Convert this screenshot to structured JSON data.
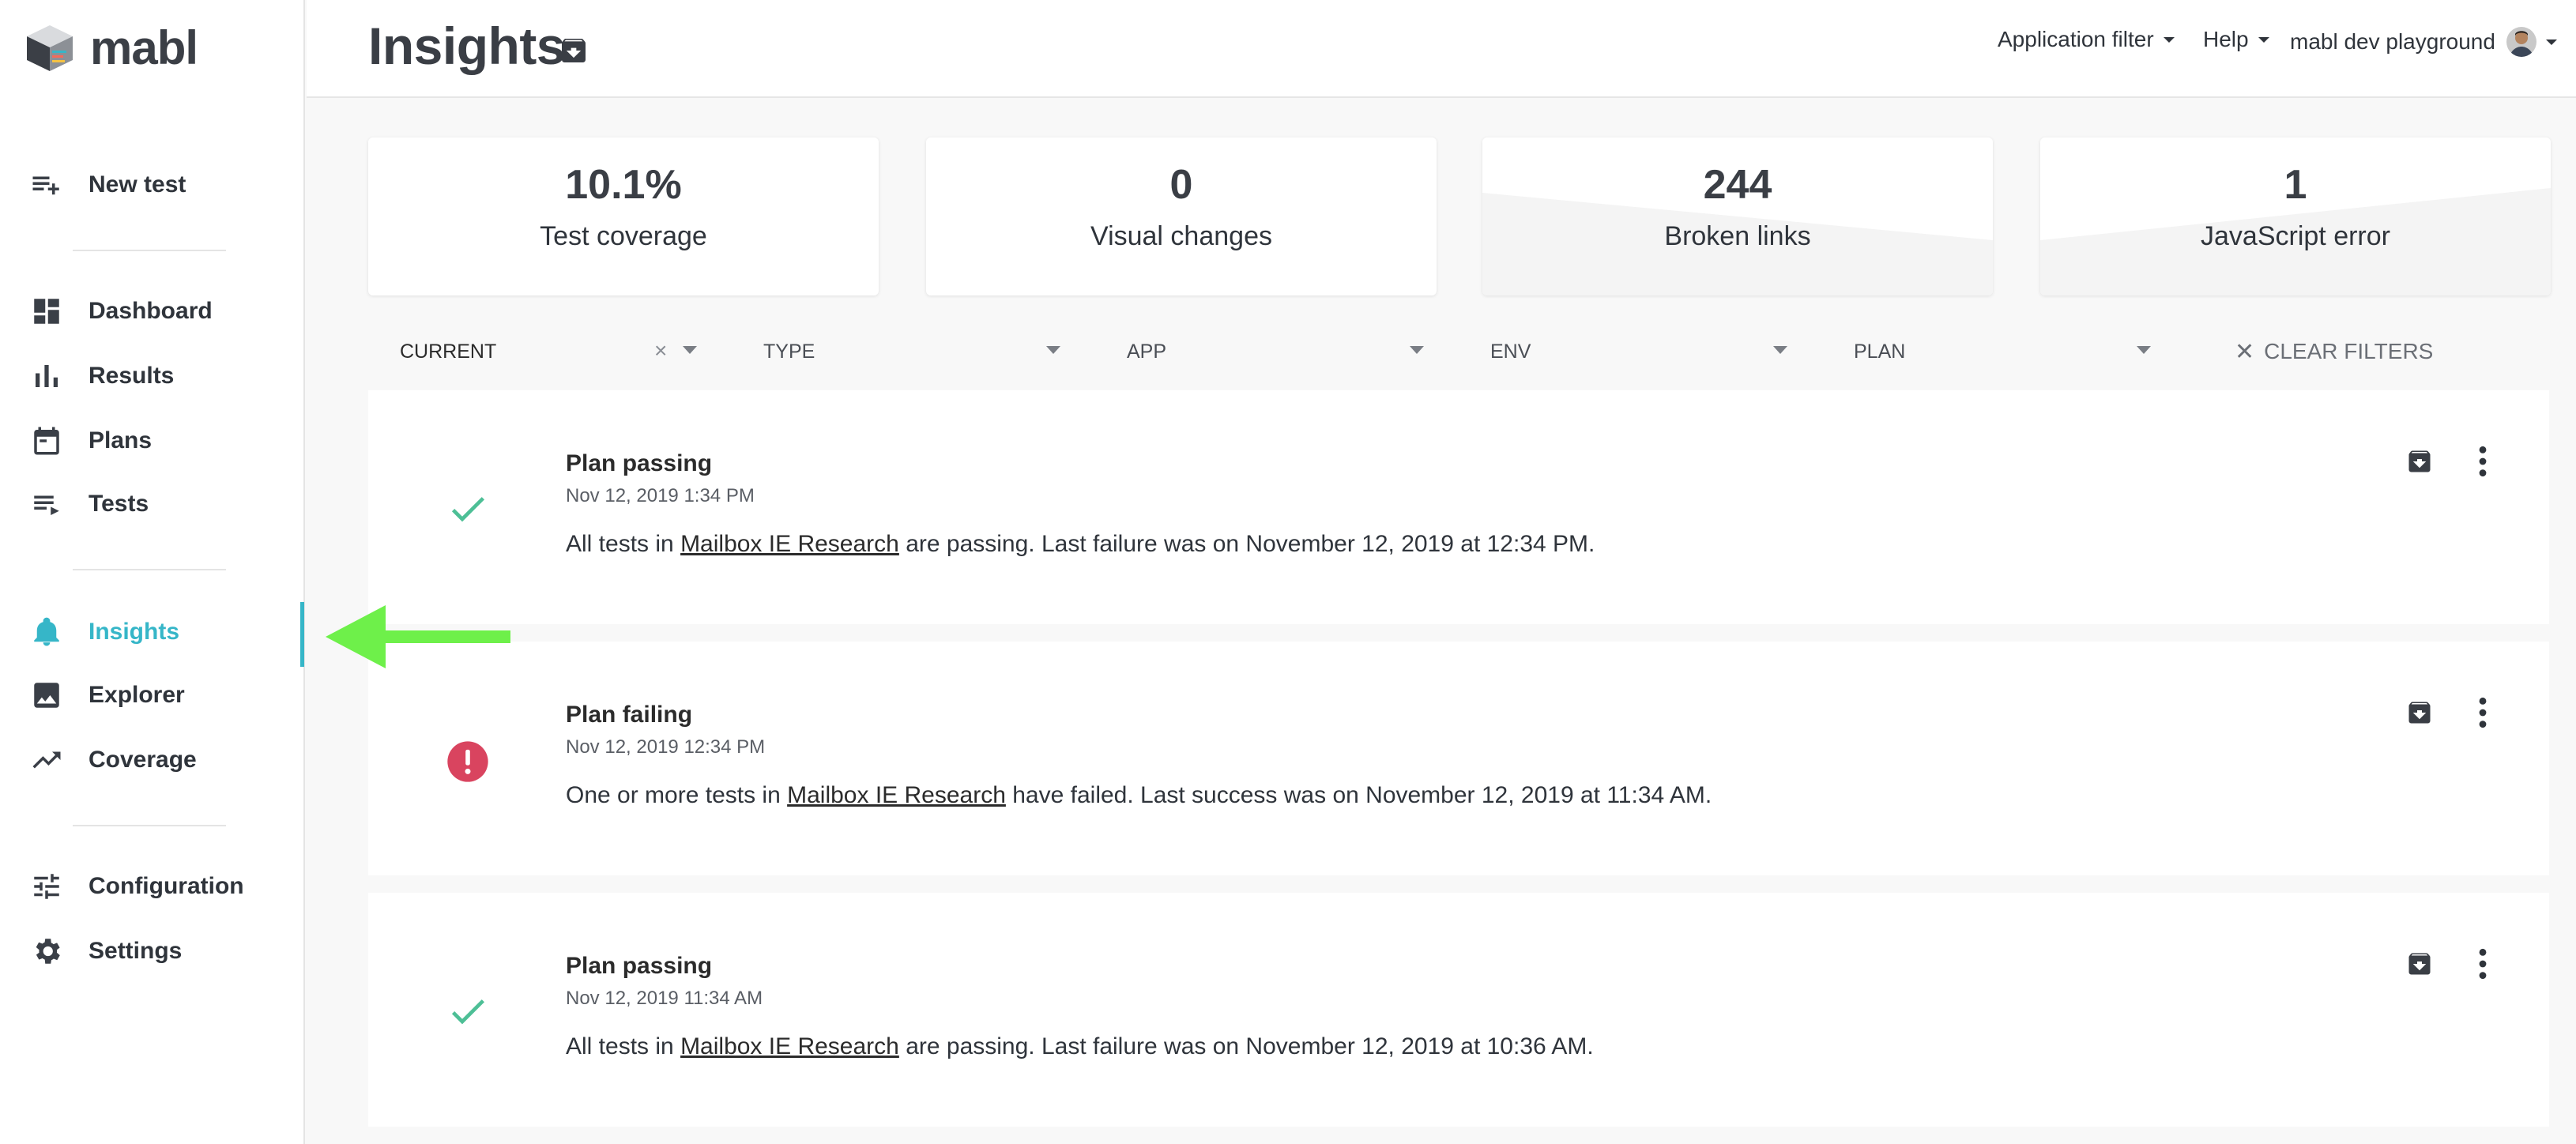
{
  "brand": {
    "name": "mabl"
  },
  "sidebar": {
    "items": [
      {
        "label": "New test",
        "icon": "playlist-add-icon"
      },
      {
        "label": "Dashboard",
        "icon": "dashboard-icon"
      },
      {
        "label": "Results",
        "icon": "bar-chart-icon"
      },
      {
        "label": "Plans",
        "icon": "calendar-icon"
      },
      {
        "label": "Tests",
        "icon": "list-icon"
      },
      {
        "label": "Insights",
        "icon": "bell-icon",
        "active": true
      },
      {
        "label": "Explorer",
        "icon": "image-icon"
      },
      {
        "label": "Coverage",
        "icon": "trending-up-icon"
      },
      {
        "label": "Configuration",
        "icon": "sliders-icon"
      },
      {
        "label": "Settings",
        "icon": "gear-icon"
      }
    ]
  },
  "header": {
    "title": "Insights",
    "menus": [
      "Application filter",
      "Help",
      "mabl dev playground"
    ]
  },
  "stats": [
    {
      "value": "10.1%",
      "caption": "Test coverage"
    },
    {
      "value": "0",
      "caption": "Visual changes"
    },
    {
      "value": "244",
      "caption": "Broken links"
    },
    {
      "value": "1",
      "caption": "JavaScript error"
    }
  ],
  "filters": {
    "current": "CURRENT",
    "type": "TYPE",
    "app": "APP",
    "env": "ENV",
    "plan": "PLAN",
    "clear": "CLEAR FILTERS"
  },
  "insights": [
    {
      "status": "passing",
      "title": "Plan passing",
      "date": "Nov 12, 2019 1:34 PM",
      "msg_pre": "All tests in ",
      "link": "Mailbox IE Research",
      "msg_post": " are passing. Last failure was on November 12, 2019 at 12:34 PM."
    },
    {
      "status": "failing",
      "title": "Plan failing",
      "date": "Nov 12, 2019 12:34 PM",
      "msg_pre": "One or more tests in ",
      "link": "Mailbox IE Research",
      "msg_post": " have failed. Last success was on November 12, 2019 at 11:34 AM."
    },
    {
      "status": "passing",
      "title": "Plan passing",
      "date": "Nov 12, 2019 11:34 AM",
      "msg_pre": "All tests in ",
      "link": "Mailbox IE Research",
      "msg_post": " are passing. Last failure was on November 12, 2019 at 10:36 AM."
    }
  ],
  "colors": {
    "accent": "#36b6c8",
    "success": "#4dbf96",
    "error": "#d9445f",
    "annotation_arrow": "#6ef04a"
  }
}
